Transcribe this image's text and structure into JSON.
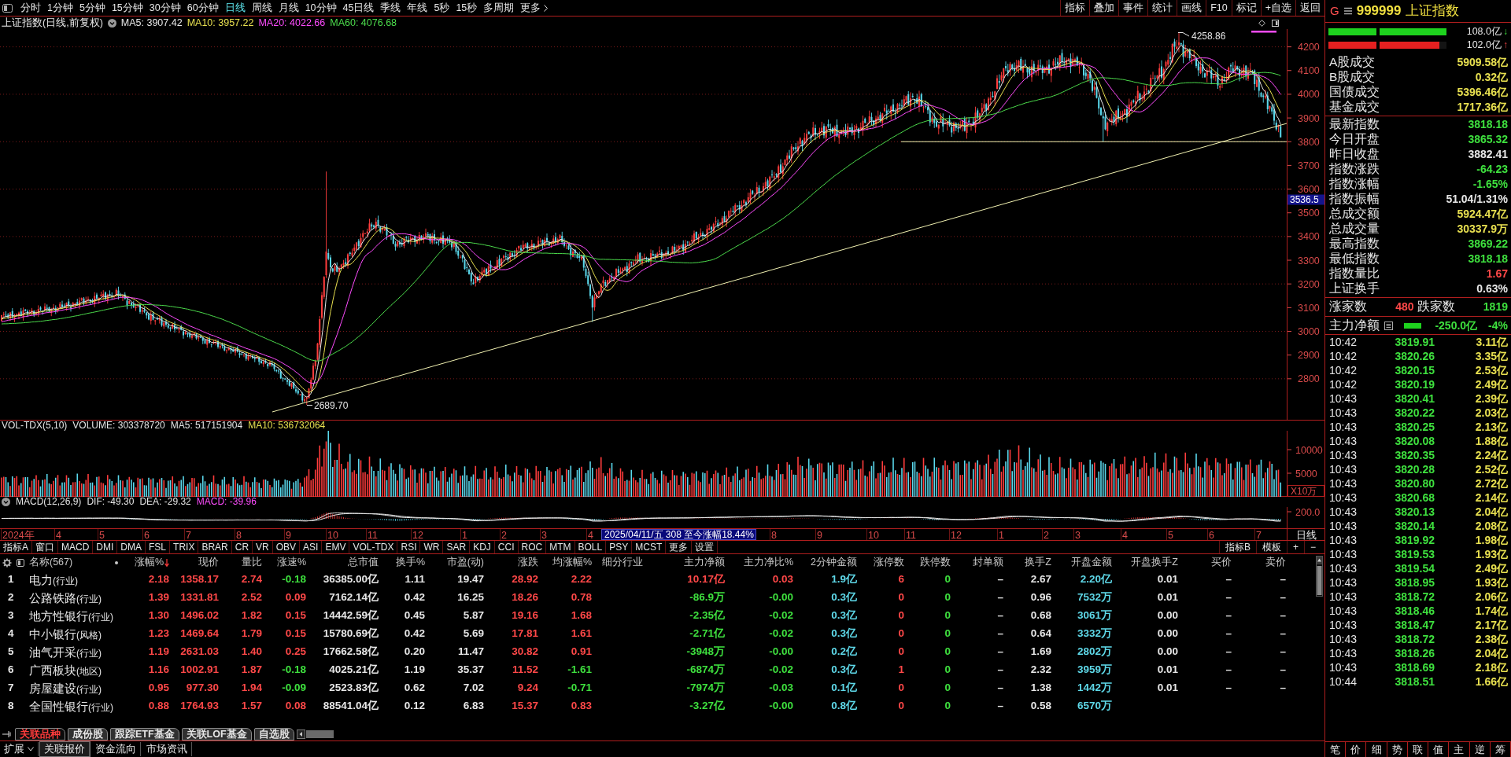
{
  "toolbar": {
    "periods": [
      {
        "label": "分时",
        "selected": false
      },
      {
        "label": "1分钟",
        "selected": false
      },
      {
        "label": "5分钟",
        "selected": false
      },
      {
        "label": "15分钟",
        "selected": false
      },
      {
        "label": "30分钟",
        "selected": false
      },
      {
        "label": "60分钟",
        "selected": false
      },
      {
        "label": "日线",
        "selected": true
      },
      {
        "label": "周线",
        "selected": false
      },
      {
        "label": "月线",
        "selected": false
      },
      {
        "label": "10分钟",
        "selected": false
      },
      {
        "label": "45日线",
        "selected": false
      },
      {
        "label": "季线",
        "selected": false
      },
      {
        "label": "年线",
        "selected": false
      },
      {
        "label": "5秒",
        "selected": false
      },
      {
        "label": "15秒",
        "selected": false
      },
      {
        "label": "多周期",
        "selected": false
      }
    ],
    "more": "更多",
    "tools": [
      "指标",
      "叠加",
      "事件",
      "统计",
      "画线",
      "F10",
      "标记",
      "+自选",
      "返回"
    ]
  },
  "chart": {
    "title": "上证指数(日线,前复权)",
    "averages": [
      {
        "label": "MA5: 3907.42",
        "color": "#e6e6e6"
      },
      {
        "label": "MA10: 3957.22",
        "color": "#e8e050"
      },
      {
        "label": "MA20: 4022.66",
        "color": "#ff4cff"
      },
      {
        "label": "MA60: 4076.68",
        "color": "#4cdc4c"
      }
    ],
    "price_axis": [
      "4200",
      "4100",
      "4000",
      "3900",
      "3800",
      "3700",
      "3600",
      "3500",
      "3400",
      "3300",
      "3200",
      "3100",
      "3000",
      "2900",
      "2800"
    ],
    "high_label": "4258.86",
    "low_label": "2689.70",
    "price_tag": "3536.5"
  },
  "volume": {
    "legend": [
      {
        "label": "VOL-TDX(5,10)",
        "color": "#e6e6e6"
      },
      {
        "label": "VOLUME: 303378720",
        "color": "#e6e6e6"
      },
      {
        "label": "MA5: 517151904",
        "color": "#e6e6e6"
      },
      {
        "label": "MA10: 536732064",
        "color": "#e8e050"
      }
    ],
    "axis": [
      "10000",
      "5000"
    ],
    "unit": "X10万"
  },
  "macd": {
    "legend": [
      {
        "label": "MACD(12,26,9)",
        "color": "#e6e6e6"
      },
      {
        "label": "DIF: -49.30",
        "color": "#e6e6e6"
      },
      {
        "label": "DEA: -29.32",
        "color": "#e6e6e6"
      },
      {
        "label": "MACD: -39.96",
        "color": "#ff4cff"
      }
    ],
    "axis": [
      "200.0"
    ]
  },
  "time_axis": {
    "labels": [
      "2024年",
      "4",
      "5",
      "6",
      "7",
      "8",
      "9",
      "10",
      "11",
      "12",
      "1",
      "2",
      "3",
      "4",
      "8",
      "9",
      "10",
      "11",
      "12",
      "1",
      "2",
      "3",
      "4",
      "5",
      "6",
      "7"
    ],
    "tooltip": "2025/04/11/五 308 至今涨幅18.44%",
    "period": "日线"
  },
  "indicator_tabs": {
    "left": [
      "指标A",
      "窗口",
      "MACD",
      "DMI",
      "DMA",
      "FSL",
      "TRIX",
      "BRAR",
      "CR",
      "VR",
      "OBV",
      "ASI",
      "EMV",
      "VOL-TDX",
      "RSI",
      "WR",
      "SAR",
      "KDJ",
      "CCI",
      "ROC",
      "MTM",
      "BOLL",
      "PSY",
      "MCST",
      "更多",
      "设置"
    ],
    "right": [
      "指标B",
      "模板",
      "+",
      "−"
    ]
  },
  "table": {
    "name_header": "名称(567)",
    "columns": [
      {
        "label": "涨幅%",
        "kind": "signed",
        "sorted": true
      },
      {
        "label": "现价",
        "kind": "trend",
        "sorted": false
      },
      {
        "label": "量比",
        "kind": "rise",
        "sorted": false
      },
      {
        "label": "涨速%",
        "kind": "signed",
        "sorted": false
      },
      {
        "label": "总市值",
        "kind": "plain",
        "sorted": false
      },
      {
        "label": "换手%",
        "kind": "plain",
        "sorted": false
      },
      {
        "label": "市盈(动)",
        "kind": "plain",
        "sorted": false
      },
      {
        "label": "涨跌",
        "kind": "signed",
        "sorted": false
      },
      {
        "label": "均涨幅%",
        "kind": "signed",
        "sorted": false
      },
      {
        "label": "细分行业",
        "kind": "text",
        "sorted": false
      },
      {
        "label": "主力净额",
        "kind": "signed",
        "sorted": false
      },
      {
        "label": "主力净比%",
        "kind": "signed",
        "sorted": false
      },
      {
        "label": "2分钟金额",
        "kind": "flow",
        "sorted": false
      },
      {
        "label": "涨停数",
        "kind": "rise",
        "sorted": false
      },
      {
        "label": "跌停数",
        "kind": "fall",
        "sorted": false
      },
      {
        "label": "封单额",
        "kind": "plain",
        "sorted": false
      },
      {
        "label": "换手Z",
        "kind": "plain",
        "sorted": false
      },
      {
        "label": "开盘金额",
        "kind": "flow",
        "sorted": false
      },
      {
        "label": "开盘换手Z",
        "kind": "plain",
        "sorted": false
      },
      {
        "label": "买价",
        "kind": "plain",
        "sorted": false
      },
      {
        "label": "卖价",
        "kind": "plain",
        "sorted": false
      }
    ],
    "rows": [
      {
        "index": "1",
        "name": "电力",
        "category": "(行业)",
        "cells": [
          "2.18",
          "1358.17",
          "2.74",
          "-0.18",
          "36385.00亿",
          "1.11",
          "19.47",
          "28.92",
          "2.22",
          "",
          "10.17亿",
          "0.03",
          "1.9亿",
          "6",
          "0",
          "–",
          "2.67",
          "2.20亿",
          "0.01",
          "–",
          "–"
        ]
      },
      {
        "index": "2",
        "name": "公路铁路",
        "category": "(行业)",
        "cells": [
          "1.39",
          "1331.81",
          "2.52",
          "0.09",
          "7162.14亿",
          "0.42",
          "16.25",
          "18.26",
          "0.78",
          "",
          "-86.9万",
          "-0.00",
          "0.3亿",
          "0",
          "0",
          "–",
          "0.96",
          "7532万",
          "0.01",
          "–",
          "–"
        ]
      },
      {
        "index": "3",
        "name": "地方性银行",
        "category": "(行业)",
        "cells": [
          "1.30",
          "1496.02",
          "1.82",
          "0.15",
          "14442.59亿",
          "0.45",
          "5.87",
          "19.16",
          "1.68",
          "",
          "-2.35亿",
          "-0.02",
          "0.3亿",
          "0",
          "0",
          "–",
          "0.68",
          "3061万",
          "0.00",
          "–",
          "–"
        ]
      },
      {
        "index": "4",
        "name": "中小银行",
        "category": "(风格)",
        "cells": [
          "1.23",
          "1469.64",
          "1.79",
          "0.15",
          "15780.69亿",
          "0.42",
          "5.69",
          "17.81",
          "1.61",
          "",
          "-2.71亿",
          "-0.02",
          "0.3亿",
          "0",
          "0",
          "–",
          "0.64",
          "3332万",
          "0.00",
          "–",
          "–"
        ]
      },
      {
        "index": "5",
        "name": "油气开采",
        "category": "(行业)",
        "cells": [
          "1.19",
          "2631.03",
          "1.40",
          "0.25",
          "17662.58亿",
          "0.20",
          "11.47",
          "30.82",
          "0.91",
          "",
          "-3948万",
          "-0.00",
          "0.2亿",
          "0",
          "0",
          "–",
          "1.69",
          "2802万",
          "0.00",
          "–",
          "–"
        ]
      },
      {
        "index": "6",
        "name": "广西板块",
        "category": "(地区)",
        "cells": [
          "1.16",
          "1002.91",
          "1.87",
          "-0.18",
          "4025.21亿",
          "1.19",
          "35.37",
          "11.52",
          "-1.61",
          "",
          "-6874万",
          "-0.02",
          "0.3亿",
          "1",
          "0",
          "–",
          "2.32",
          "3959万",
          "0.01",
          "–",
          "–"
        ]
      },
      {
        "index": "7",
        "name": "房屋建设",
        "category": "(行业)",
        "cells": [
          "0.95",
          "977.30",
          "1.94",
          "-0.09",
          "2523.83亿",
          "0.62",
          "7.02",
          "9.24",
          "-0.71",
          "",
          "-7974万",
          "-0.03",
          "0.1亿",
          "0",
          "0",
          "–",
          "1.38",
          "1442万",
          "0.01",
          "–",
          "–"
        ]
      },
      {
        "index": "8",
        "name": "全国性银行",
        "category": "(行业)",
        "cells": [
          "0.88",
          "1764.93",
          "1.57",
          "0.08",
          "88541.04亿",
          "0.12",
          "6.83",
          "15.37",
          "0.83",
          "",
          "-3.27亿",
          "-0.00",
          "0.8亿",
          "0",
          "0",
          "–",
          "0.58",
          "6570万"
        ]
      }
    ]
  },
  "sheet_tabs": [
    {
      "label": "关联品种",
      "selected": true
    },
    {
      "label": "成份股",
      "selected": false
    },
    {
      "label": "跟踪ETF基金",
      "selected": false
    },
    {
      "label": "关联LOF基金",
      "selected": false
    },
    {
      "label": "自选股",
      "selected": false
    }
  ],
  "bottom_bar": {
    "expand": "扩展",
    "links": [
      {
        "label": "关联报价",
        "selected": true
      },
      {
        "label": "资金流向",
        "selected": false
      },
      {
        "label": "市场资讯",
        "selected": false
      }
    ]
  },
  "quote_panel": {
    "flag": "G",
    "code": "999999",
    "name": "上证指数",
    "flow_bars": [
      {
        "reading": "108.0亿",
        "arrow": "↓",
        "kind": "outflow",
        "level": 1
      },
      {
        "reading": "102.0亿",
        "arrow": "↑",
        "kind": "inflow",
        "level": 0.94
      }
    ],
    "turnover": [
      {
        "label": "A股成交",
        "value": "5909.58亿"
      },
      {
        "label": "B股成交",
        "value": "0.32亿"
      },
      {
        "label": "国债成交",
        "value": "5396.46亿"
      },
      {
        "label": "基金成交",
        "value": "1717.36亿"
      }
    ],
    "stats": [
      {
        "label": "最新指数",
        "value": "3818.18",
        "color": "#3ee03e"
      },
      {
        "label": "今日开盘",
        "value": "3865.32",
        "color": "#3ee03e"
      },
      {
        "label": "昨日收盘",
        "value": "3882.41",
        "color": "#e6e6e6"
      },
      {
        "label": "指数涨跌",
        "value": "-64.23",
        "color": "#3ee03e"
      },
      {
        "label": "指数涨幅",
        "value": "-1.65%",
        "color": "#3ee03e"
      },
      {
        "label": "指数振幅",
        "value": "51.04/1.31%",
        "color": "#e6e6e6"
      },
      {
        "label": "总成交额",
        "value": "5924.47亿",
        "color": "#e8e050"
      },
      {
        "label": "总成交量",
        "value": "30337.9万",
        "color": "#e8e050"
      },
      {
        "label": "最高指数",
        "value": "3869.22",
        "color": "#3ee03e"
      },
      {
        "label": "最低指数",
        "value": "3818.18",
        "color": "#3ee03e"
      },
      {
        "label": "指数量比",
        "value": "1.67",
        "color": "#ff4848"
      },
      {
        "label": "上证换手",
        "value": "0.63%",
        "color": "#e6e6e6"
      }
    ],
    "breadth": {
      "up_label": "涨家数",
      "up": "480",
      "down_label": "跌家数",
      "down": "1819"
    },
    "main_flow": {
      "label": "主力净额",
      "amount": "-250.0亿",
      "ratio": "-4%"
    },
    "ticks": [
      {
        "time": "10:42",
        "price": "3819.91",
        "amount": "3.11亿"
      },
      {
        "time": "10:42",
        "price": "3820.26",
        "amount": "3.35亿"
      },
      {
        "time": "10:42",
        "price": "3820.15",
        "amount": "2.53亿"
      },
      {
        "time": "10:42",
        "price": "3820.19",
        "amount": "2.49亿"
      },
      {
        "time": "10:43",
        "price": "3820.41",
        "amount": "2.39亿"
      },
      {
        "time": "10:43",
        "price": "3820.22",
        "amount": "2.03亿"
      },
      {
        "time": "10:43",
        "price": "3820.25",
        "amount": "2.13亿"
      },
      {
        "time": "10:43",
        "price": "3820.08",
        "amount": "1.88亿"
      },
      {
        "time": "10:43",
        "price": "3820.35",
        "amount": "2.24亿"
      },
      {
        "time": "10:43",
        "price": "3820.28",
        "amount": "2.52亿"
      },
      {
        "time": "10:43",
        "price": "3820.80",
        "amount": "2.72亿"
      },
      {
        "time": "10:43",
        "price": "3820.68",
        "amount": "2.14亿"
      },
      {
        "time": "10:43",
        "price": "3820.13",
        "amount": "2.04亿"
      },
      {
        "time": "10:43",
        "price": "3820.14",
        "amount": "2.08亿"
      },
      {
        "time": "10:43",
        "price": "3819.92",
        "amount": "1.98亿"
      },
      {
        "time": "10:43",
        "price": "3819.53",
        "amount": "1.93亿"
      },
      {
        "time": "10:43",
        "price": "3819.54",
        "amount": "2.49亿"
      },
      {
        "time": "10:43",
        "price": "3818.95",
        "amount": "1.93亿"
      },
      {
        "time": "10:43",
        "price": "3818.72",
        "amount": "2.06亿"
      },
      {
        "time": "10:43",
        "price": "3818.46",
        "amount": "1.74亿"
      },
      {
        "time": "10:43",
        "price": "3818.47",
        "amount": "2.17亿"
      },
      {
        "time": "10:43",
        "price": "3818.72",
        "amount": "2.38亿"
      },
      {
        "time": "10:43",
        "price": "3818.26",
        "amount": "2.04亿"
      },
      {
        "time": "10:43",
        "price": "3818.69",
        "amount": "2.18亿"
      },
      {
        "time": "10:44",
        "price": "3818.51",
        "amount": "1.66亿"
      }
    ],
    "side_tabs": [
      "笔",
      "价",
      "细",
      "势",
      "联",
      "值",
      "主",
      "逆",
      "筹"
    ]
  }
}
